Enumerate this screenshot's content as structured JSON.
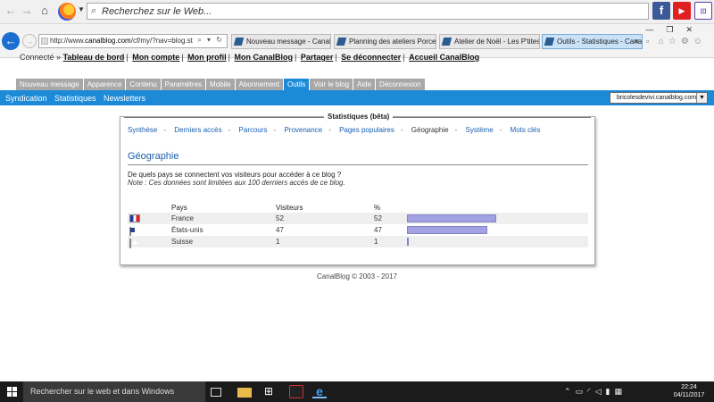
{
  "browser": {
    "search_placeholder": "Recherchez sur le Web...",
    "address_url_prefix": "http://www.",
    "address_url_domain": "canalblog.com",
    "address_url_rest": "/cf/my/?nav=blog.stat2&t",
    "address_controls": "⌕ ▾ ↻",
    "tabs": [
      {
        "label": "Nouveau message - CanalBlog"
      },
      {
        "label": "Planning des ateliers Porcelain..."
      },
      {
        "label": "Atelier de Noël - Les P'tites Bri..."
      },
      {
        "label": "Outils - Statistiques - Canal..."
      }
    ]
  },
  "canalblog": {
    "connected_label": "Connecté »",
    "user_links": [
      "Tableau de bord",
      "Mon compte",
      "Mon profil",
      "Mon CanalBlog",
      "Partager",
      "Se déconnecter",
      "Accueil CanalBlog"
    ],
    "menu_tabs": [
      "Nouveau message",
      "Apparence",
      "Contenu",
      "Paramètres",
      "Mobile",
      "Abonnement",
      "Outils",
      "Voir le blog",
      "Aide",
      "Déconnexion"
    ],
    "active_tab": "Outils",
    "sub_links": [
      "Syndication",
      "Statistiques",
      "Newsletters"
    ],
    "blog_select_value": "bricolesdevivi.canalblog.com"
  },
  "stats": {
    "panel_title": "Statistiques (bêta)",
    "subnav": [
      "Synthèse",
      "Derniers accès",
      "Parcours",
      "Provenance",
      "Pages populaires",
      "Géographie",
      "Système",
      "Mots clés"
    ],
    "current_subnav": "Géographie",
    "section_title": "Géographie",
    "question": "De quels pays se connectent vos visiteurs pour accéder à ce blog ?",
    "note": "Note : Ces données sont limitées aux 100 derniers accès de ce blog.",
    "columns": {
      "country": "Pays",
      "visitors": "Visiteurs",
      "percent": "%"
    },
    "rows": [
      {
        "flag": "france-flag",
        "country": "France",
        "visitors": "52",
        "percent": "52",
        "share": 0.52
      },
      {
        "flag": "usa-flag",
        "country": "États-unis",
        "visitors": "47",
        "percent": "47",
        "share": 0.47
      },
      {
        "flag": "switzerland-flag",
        "country": "Suisse",
        "visitors": "1",
        "percent": "1",
        "share": 0.01
      }
    ]
  },
  "footer": "CanalBlog © 2003 - 2017",
  "taskbar": {
    "search_placeholder": "Rechercher sur le web et dans Windows",
    "time": "22:24",
    "date": "04/11/2017"
  },
  "colors": {
    "accent_blue": "#1d8ad8",
    "bar_fill": "#a1a1e3",
    "link_blue": "#1a5fb0"
  }
}
